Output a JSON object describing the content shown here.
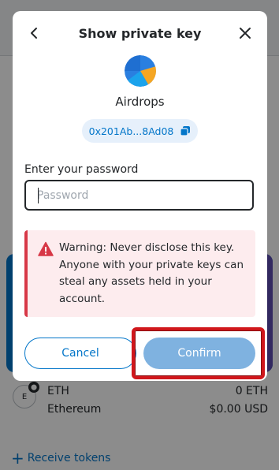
{
  "modal": {
    "title": "Show private key",
    "account_name": "Airdrops",
    "address": "0x201Ab...8Ad08",
    "password_label": "Enter your password",
    "password_placeholder": "Password",
    "password_value": "",
    "warning_text": "Warning: Never disclose this key. Anyone with your private keys can steal any assets held in your account.",
    "cancel_label": "Cancel",
    "confirm_label": "Confirm",
    "icons": {
      "back": "chevron-left-icon",
      "close": "close-icon",
      "copy": "copy-icon",
      "warning": "warning-icon"
    }
  },
  "background": {
    "asset": {
      "symbol": "ETH",
      "icon_letter": "E",
      "network": "Ethereum",
      "amount": "0 ETH",
      "fiat": "$0.00 USD"
    },
    "receive_label": "Receive tokens"
  },
  "colors": {
    "primary": "#0376c9",
    "danger": "#d73847",
    "danger_bg": "#fdecee",
    "confirm_disabled": "#7fb2e0",
    "highlight": "#d0171c"
  }
}
